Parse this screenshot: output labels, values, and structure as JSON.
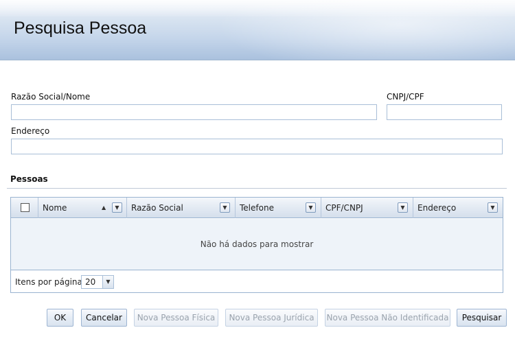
{
  "header": {
    "title": "Pesquisa Pessoa"
  },
  "form": {
    "razao_label": "Razão Social/Nome",
    "razao_value": "",
    "cnpj_label": "CNPJ/CPF",
    "cnpj_value": "",
    "endereco_label": "Endereço",
    "endereco_value": ""
  },
  "section": {
    "title": "Pessoas"
  },
  "grid": {
    "columns": [
      {
        "label": "Nome",
        "sorted": "asc"
      },
      {
        "label": "Razão Social"
      },
      {
        "label": "Telefone"
      },
      {
        "label": "CPF/CNPJ"
      },
      {
        "label": "Endereço"
      }
    ],
    "empty_message": "Não há dados para mostrar",
    "pager": {
      "label": "Itens por página:",
      "value": "20"
    }
  },
  "buttons": {
    "ok": "OK",
    "cancelar": "Cancelar",
    "nova_fisica": "Nova Pessoa Física",
    "nova_juridica": "Nova Pessoa Jurídica",
    "nova_nao_identificada": "Nova Pessoa Não Identificada",
    "pesquisar": "Pesquisar"
  },
  "icons": {
    "sort": "sort-asc-icon",
    "column_menu": "chevron-down-icon",
    "pager_dropdown": "chevron-down-icon"
  },
  "colors": {
    "header_gradient_top": "#e9eff7",
    "header_gradient_bottom": "#aac1de",
    "grid_border": "#99b3d0",
    "grid_body": "#eef3f9",
    "disabled_text": "#9aa3ad"
  }
}
